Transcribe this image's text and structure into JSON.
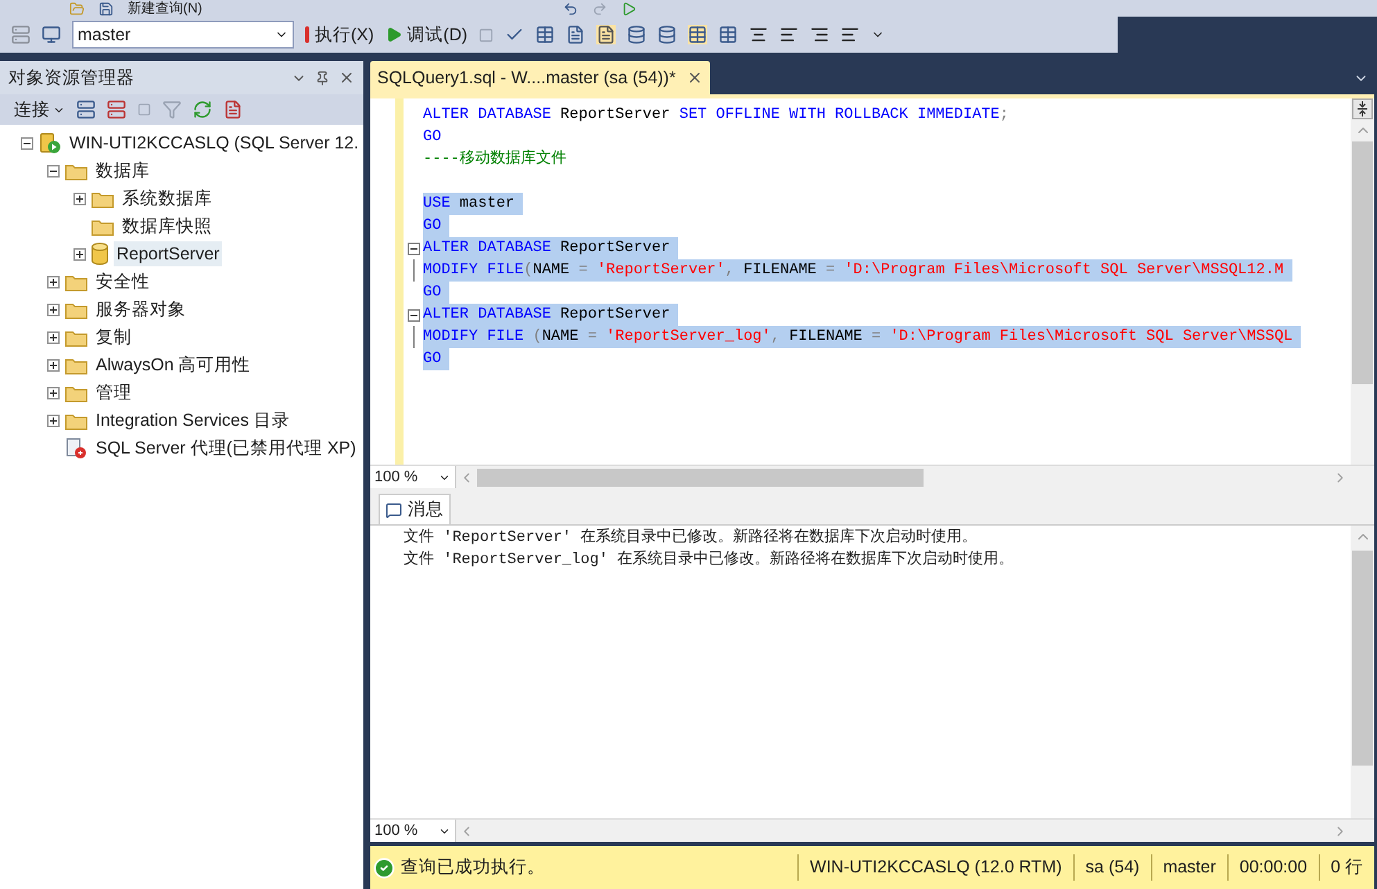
{
  "toolbar_top": {
    "new_query": "新建查询(N)"
  },
  "toolbar": {
    "database": "master",
    "execute": "执行(X)",
    "debug": "调试(D)"
  },
  "object_explorer": {
    "title": "对象资源管理器",
    "connect": "连接",
    "tree": [
      {
        "kind": "server",
        "label": "WIN-UTI2KCCASLQ (SQL Server 12.",
        "expanded": true,
        "selected": false,
        "children": [
          {
            "kind": "folder",
            "label": "数据库",
            "expanded": true,
            "selected": false,
            "children": [
              {
                "kind": "folder",
                "label": "系统数据库",
                "expanded": false,
                "selected": false
              },
              {
                "kind": "folder",
                "label": "数据库快照",
                "selected": false
              },
              {
                "kind": "database",
                "label": "ReportServer",
                "expanded": false,
                "selected": true
              }
            ]
          },
          {
            "kind": "folder",
            "label": "安全性",
            "expanded": false,
            "selected": false
          },
          {
            "kind": "folder",
            "label": "服务器对象",
            "expanded": false,
            "selected": false
          },
          {
            "kind": "folder",
            "label": "复制",
            "expanded": false,
            "selected": false
          },
          {
            "kind": "folder",
            "label": "AlwaysOn 高可用性",
            "expanded": false,
            "selected": false
          },
          {
            "kind": "folder",
            "label": "管理",
            "expanded": false,
            "selected": false
          },
          {
            "kind": "folder",
            "label": "Integration Services 目录",
            "expanded": false,
            "selected": false
          },
          {
            "kind": "agent",
            "label": "SQL Server 代理(已禁用代理 XP)",
            "selected": false
          }
        ]
      }
    ]
  },
  "editor": {
    "tab": {
      "title": "SQLQuery1.sql - W....master (sa (54))*",
      "selected": true
    },
    "zoom": "100 %",
    "lines": [
      {
        "selected": false,
        "tokens": [
          {
            "kind": "keyword",
            "text": "ALTER DATABASE"
          },
          {
            "kind": "plain",
            "text": " ReportServer "
          },
          {
            "kind": "keyword",
            "text": "SET OFFLINE WITH ROLLBACK IMMEDIATE"
          },
          {
            "kind": "punct",
            "text": ";"
          }
        ]
      },
      {
        "selected": false,
        "tokens": [
          {
            "kind": "keyword",
            "text": "GO"
          }
        ]
      },
      {
        "selected": false,
        "tokens": [
          {
            "kind": "comment",
            "text": "----移动数据库文件"
          }
        ]
      },
      {
        "selected": false
      },
      {
        "selected": true,
        "tokens": [
          {
            "kind": "keyword",
            "text": "USE"
          },
          {
            "kind": "plain",
            "text": " master"
          }
        ]
      },
      {
        "selected": true,
        "tokens": [
          {
            "kind": "keyword",
            "text": "GO"
          }
        ]
      },
      {
        "selected": true,
        "fold_start": true,
        "tokens": [
          {
            "kind": "keyword",
            "text": "ALTER DATABASE"
          },
          {
            "kind": "plain",
            "text": " ReportServer"
          }
        ]
      },
      {
        "selected": true,
        "fold_body": true,
        "tokens": [
          {
            "kind": "keyword",
            "text": "MODIFY FILE"
          },
          {
            "kind": "punct",
            "text": "("
          },
          {
            "kind": "plain",
            "text": "NAME "
          },
          {
            "kind": "punct",
            "text": "= "
          },
          {
            "kind": "string",
            "text": "'ReportServer'"
          },
          {
            "kind": "punct",
            "text": ","
          },
          {
            "kind": "plain",
            "text": " FILENAME "
          },
          {
            "kind": "punct",
            "text": "= "
          },
          {
            "kind": "string",
            "text": "'D:\\Program Files\\Microsoft SQL Server\\MSSQL12.M"
          }
        ]
      },
      {
        "selected": true,
        "tokens": [
          {
            "kind": "keyword",
            "text": "GO"
          }
        ]
      },
      {
        "selected": true,
        "fold_start": true,
        "tokens": [
          {
            "kind": "keyword",
            "text": "ALTER DATABASE"
          },
          {
            "kind": "plain",
            "text": " ReportServer"
          }
        ]
      },
      {
        "selected": true,
        "fold_body": true,
        "tokens": [
          {
            "kind": "keyword",
            "text": "MODIFY FILE "
          },
          {
            "kind": "punct",
            "text": "("
          },
          {
            "kind": "plain",
            "text": "NAME "
          },
          {
            "kind": "punct",
            "text": "= "
          },
          {
            "kind": "string",
            "text": "'ReportServer_log'"
          },
          {
            "kind": "punct",
            "text": ","
          },
          {
            "kind": "plain",
            "text": " FILENAME "
          },
          {
            "kind": "punct",
            "text": "= "
          },
          {
            "kind": "string",
            "text": "'D:\\Program Files\\Microsoft SQL Server\\MSSQL"
          }
        ]
      },
      {
        "selected": true,
        "tokens": [
          {
            "kind": "keyword",
            "text": "GO"
          }
        ]
      }
    ]
  },
  "results": {
    "tabs": [
      {
        "label": "消息",
        "selected": true
      }
    ],
    "zoom": "100 %",
    "messages": [
      "文件 'ReportServer' 在系统目录中已修改。新路径将在数据库下次启动时使用。",
      "文件 'ReportServer_log' 在系统目录中已修改。新路径将在数据库下次启动时使用。"
    ]
  },
  "status_bar": {
    "message": "查询已成功执行。",
    "server": "WIN-UTI2KCCASLQ (12.0 RTM)",
    "user": "sa (54)",
    "database": "master",
    "elapsed": "00:00:00",
    "rows": "0 行"
  }
}
